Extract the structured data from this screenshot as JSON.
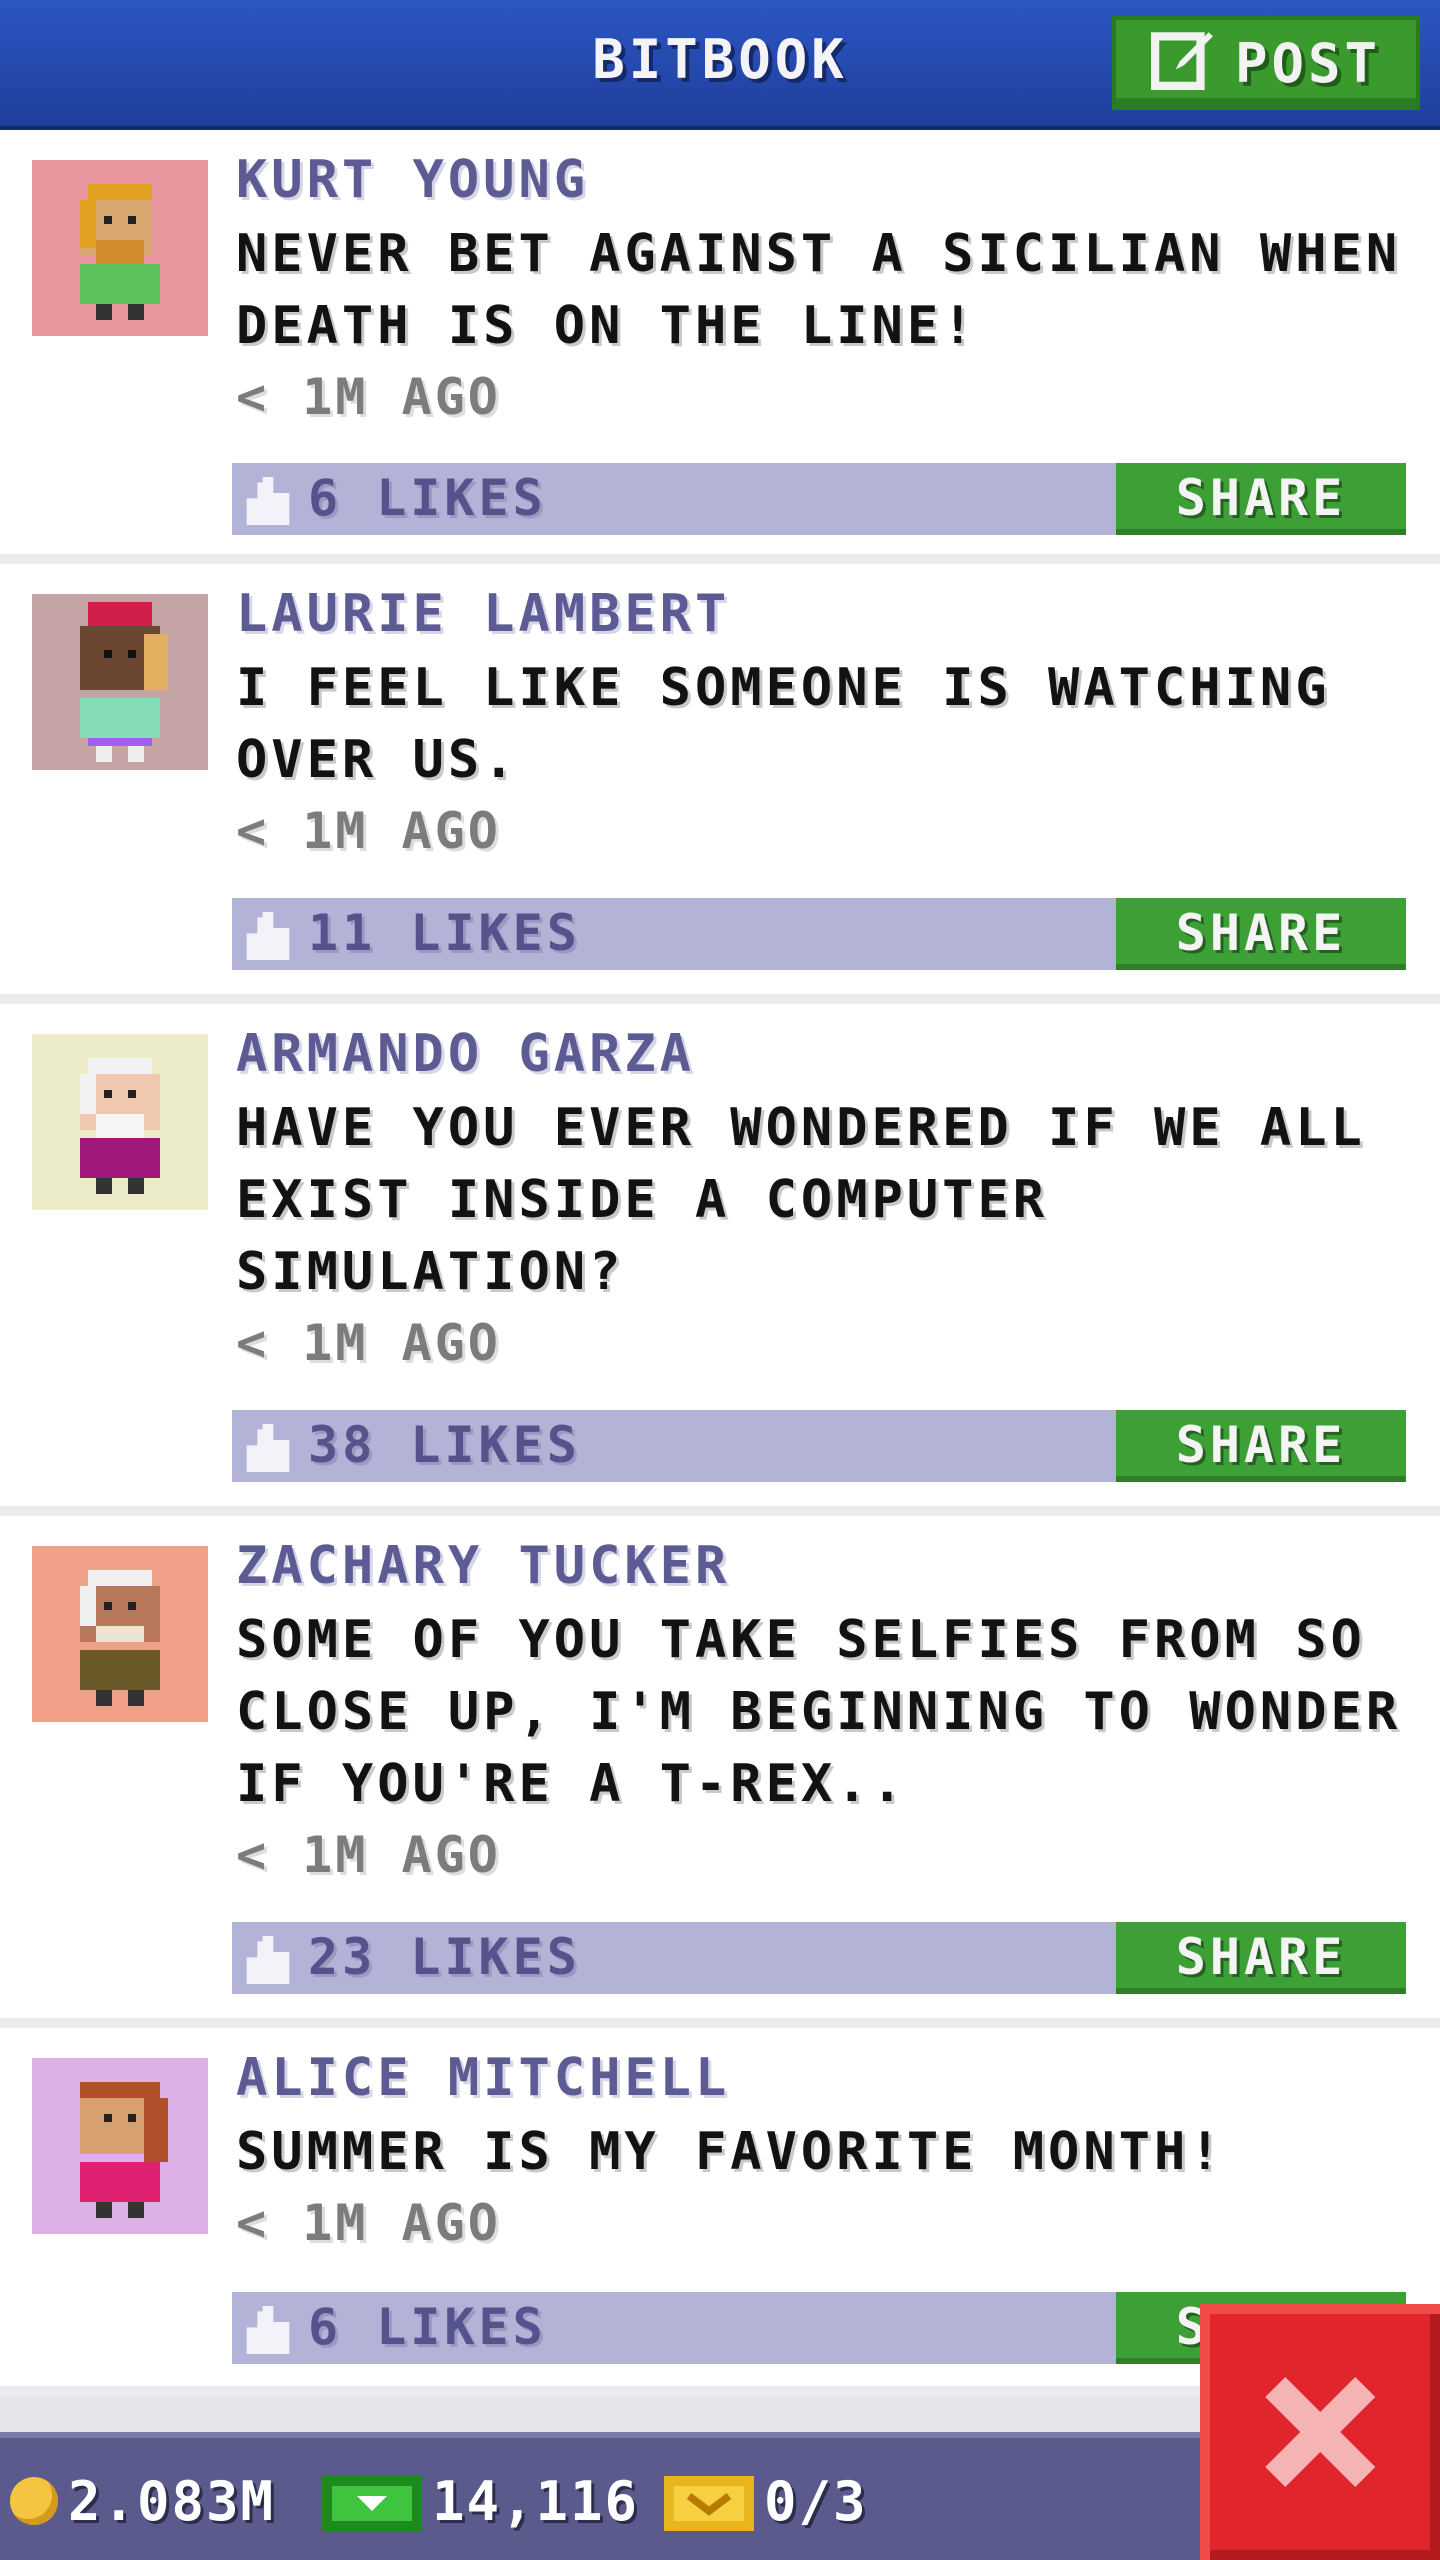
{
  "header": {
    "title": "BITBOOK",
    "post_label": "POST"
  },
  "posts": [
    {
      "name": "KURT YOUNG",
      "message": "NEVER BET AGAINST A SICILIAN WHEN DEATH IS ON THE LINE!",
      "time": "< 1M AGO",
      "likes": "6 LIKES",
      "share_label": "SHARE",
      "avatar_bg": "#e9959d"
    },
    {
      "name": "LAURIE LAMBERT",
      "message": "I FEEL LIKE SOMEONE IS WATCHING OVER US.",
      "time": "< 1M AGO",
      "likes": "11 LIKES",
      "share_label": "SHARE",
      "avatar_bg": "#c4a4a4"
    },
    {
      "name": "ARMANDO GARZA",
      "message": "HAVE YOU EVER WONDERED IF WE ALL EXIST INSIDE A COMPUTER SIMULATION?",
      "time": "< 1M AGO",
      "likes": "38 LIKES",
      "share_label": "SHARE",
      "avatar_bg": "#ececc8"
    },
    {
      "name": "ZACHARY TUCKER",
      "message": "SOME OF YOU TAKE SELFIES FROM SO CLOSE UP, I'M BEGINNING TO WONDER IF YOU'RE A T-REX..",
      "time": "< 1M AGO",
      "likes": "23 LIKES",
      "share_label": "SHARE",
      "avatar_bg": "#efa086"
    },
    {
      "name": "ALICE MITCHELL",
      "message": "SUMMER IS MY FAVORITE MONTH!",
      "time": "< 1M AGO",
      "likes": "6 LIKES",
      "share_label": "SHARE",
      "avatar_bg": "#ddb0e8"
    }
  ],
  "statusbar": {
    "coins": "2.083M",
    "bux": "14,116",
    "tickets": "0/3"
  },
  "icons": {
    "post": "edit-icon",
    "like": "thumbs-up-icon",
    "close": "close-icon",
    "coin": "coin-icon",
    "bux": "bux-icon",
    "ticket": "ticket-icon"
  },
  "colors": {
    "header": "#2648b0",
    "accent_green": "#3da036",
    "like_bar": "#b3b3d7",
    "close": "#e0262c"
  }
}
